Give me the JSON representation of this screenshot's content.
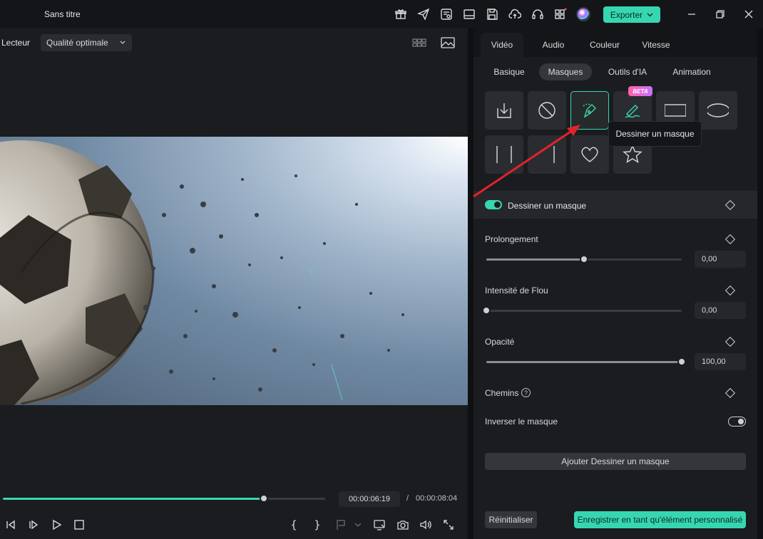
{
  "window": {
    "title": "Sans titre",
    "export_label": "Exporter"
  },
  "player": {
    "label": "Lecteur",
    "quality": "Qualité optimale",
    "current_time": "00:00:06:19",
    "separator": "/",
    "total_time": "00:00:08:04",
    "progress_fraction": 0.81,
    "brace_open": "{",
    "brace_close": "}"
  },
  "panel": {
    "tabs": [
      "Vidéo",
      "Audio",
      "Couleur",
      "Vitesse"
    ],
    "active_tab": "Vidéo",
    "subtabs": [
      "Basique",
      "Masques",
      "Outils d'IA",
      "Animation"
    ],
    "active_subtab": "Masques",
    "beta_label": "BETA",
    "tooltip": "Dessiner un masque",
    "section_title": "Dessiner un masque",
    "props": {
      "prolongement": {
        "label": "Prolongement",
        "value": "0,00",
        "fraction": 0.5
      },
      "flou": {
        "label": "Intensité de Flou",
        "value": "0,00",
        "fraction": 0.0
      },
      "opacite": {
        "label": "Opacité",
        "value": "100,00",
        "fraction": 1.0
      }
    },
    "paths_label": "Chemins",
    "help_glyph": "?",
    "invert_label": "Inverser le masque",
    "add_button": "Ajouter Dessiner un masque",
    "reset_button": "Réinitialiser",
    "save_button": "Enregistrer en tant qu'élément personnalisé"
  },
  "colors": {
    "accent": "#36d7b0",
    "annotation_arrow": "#e0242b",
    "beta_start": "#ff5fa8",
    "beta_end": "#c673ff"
  }
}
